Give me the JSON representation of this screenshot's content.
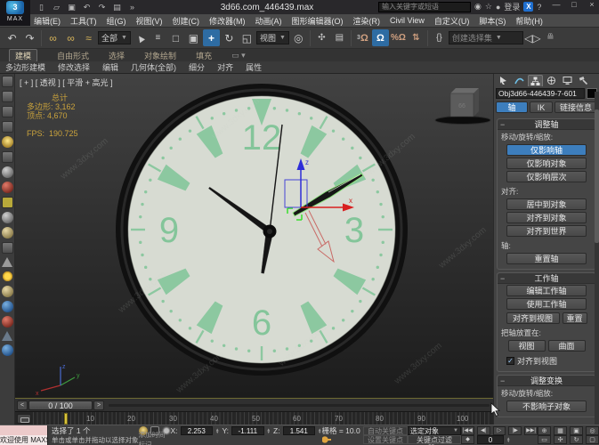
{
  "titlebar": {
    "title": "3d66.com_446439.max",
    "search_placeholder": "输入关键字或短语",
    "login_label": "登录",
    "logo_text": "3",
    "logo_sub": "MAX",
    "minimize": "—",
    "maximize": "□",
    "close": "×"
  },
  "menus": [
    "编辑(E)",
    "工具(T)",
    "组(G)",
    "视图(V)",
    "创建(C)",
    "修改器(M)",
    "动画(A)",
    "图形编辑器(O)",
    "渲染(R)",
    "Civil View",
    "自定义(U)",
    "脚本(S)",
    "帮助(H)"
  ],
  "toolbar": {
    "selection_filter": "全部",
    "ref_coord": "视图",
    "named_selection_placeholder": "创建选择集",
    "undo": "↶",
    "redo": "↷"
  },
  "ribbon": {
    "tabs": [
      "建模",
      "自由形式",
      "选择",
      "对象绘制",
      "填充"
    ],
    "panels": [
      "多边形建模",
      "修改选择",
      "编辑",
      "几何体(全部)",
      "细分",
      "对齐",
      "属性"
    ]
  },
  "viewport": {
    "label": "[ + ] [ 透视 ] [ 平滑 + 高光 ]",
    "stats": {
      "total_label": "总计",
      "poly_label": "多边形:",
      "poly_value": "3,162",
      "vert_label": "顶点:",
      "vert_value": "4,670",
      "fps_label": "FPS:",
      "fps_value": "190.725"
    },
    "watermark": "www.3dxy.com",
    "clock": {
      "numbers": [
        "12",
        "3",
        "6",
        "9"
      ],
      "gizmo_x_label": "x",
      "gizmo_z_label": "z"
    }
  },
  "right_panel": {
    "object_name": "Obj3d66-446439-7-601",
    "mode_tabs": {
      "pivot": "轴",
      "ik": "IK",
      "link_info": "链接信息"
    },
    "adjust_pivot": {
      "title": "调整轴",
      "move_label": "移动/旋转/缩放:",
      "affect_pivot": "仅影响轴",
      "affect_object": "仅影响对象",
      "affect_hierarchy": "仅影响层次",
      "align_label": "对齐:",
      "center_to_object": "居中到对象",
      "align_to_object": "对齐到对象",
      "align_to_world": "对齐到世界",
      "pivot_label": "轴:",
      "reset_pivot": "重置轴"
    },
    "working_pivot": {
      "title": "工作轴",
      "edit": "编辑工作轴",
      "use": "使用工作轴",
      "align_to_view": "对齐到视图",
      "reset": "重置",
      "place_label": "把轴放置在:",
      "view_btn": "视图",
      "surface_btn": "曲面",
      "align_view_checkbox": "对齐到视图",
      "check_glyph": "✓"
    },
    "adjust_transform": {
      "title": "调整变换",
      "move_label": "移动/旋转/缩放:",
      "dont_affect_children": "不影响子对象"
    }
  },
  "timeline": {
    "frame_label": "0 / 100",
    "prev": "<",
    "next": ">",
    "ticks": [
      "10",
      "20",
      "30",
      "40",
      "50",
      "60",
      "70",
      "80",
      "90",
      "100"
    ]
  },
  "statusbar": {
    "welcome": "欢迎使用 MAXScript",
    "selection": "选择了 1 个",
    "prompt": "单击或单击并拖动以选择对象",
    "time_tag": "添加时间标记",
    "x_label": "X:",
    "x_value": "2.253",
    "y_label": "Y:",
    "y_value": "-1.111",
    "z_label": "Z:",
    "z_value": "1.541",
    "grid": "栅格 = 10.0",
    "auto_key": "自动关键点",
    "set_key": "设置关键点",
    "selection_set": "选定对象",
    "key_filters": "关键点过滤器...",
    "time_value": "0"
  }
}
